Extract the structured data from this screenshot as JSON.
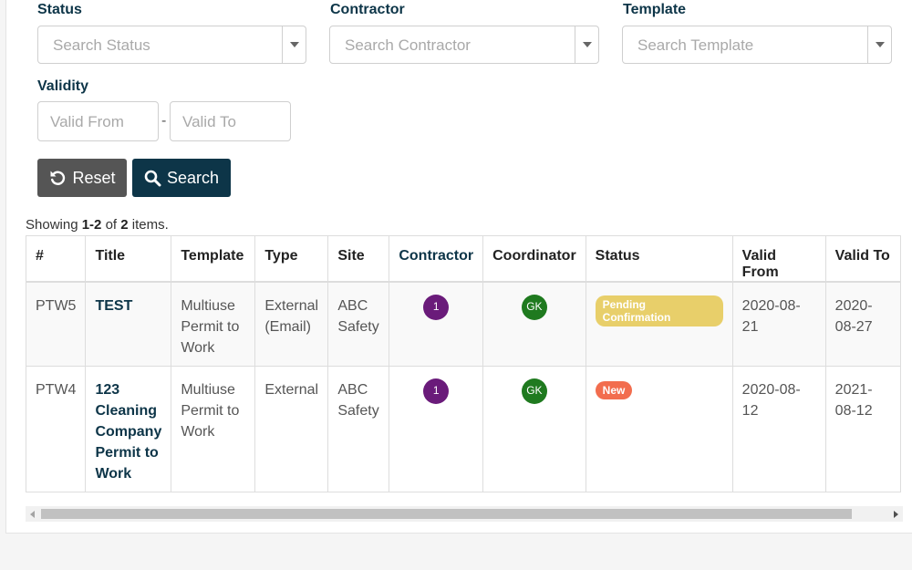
{
  "filters": {
    "status": {
      "label": "Status",
      "placeholder": "Search Status"
    },
    "contractor": {
      "label": "Contractor",
      "placeholder": "Search Contractor"
    },
    "template": {
      "label": "Template",
      "placeholder": "Search Template"
    },
    "validity": {
      "label": "Validity",
      "from_placeholder": "Valid From",
      "to_placeholder": "Valid To",
      "separator": "-"
    }
  },
  "buttons": {
    "reset": "Reset",
    "search": "Search"
  },
  "summary": {
    "prefix": "Showing ",
    "range": "1-2",
    "middle": " of ",
    "total": "2",
    "suffix": " items."
  },
  "table": {
    "columns": [
      "#",
      "Title",
      "Template",
      "Type",
      "Site",
      "Contractor",
      "Coordinator",
      "Status",
      "Valid From",
      "Valid To"
    ],
    "rows": [
      {
        "id": "PTW5",
        "title": "TEST",
        "template": "Multiuse Permit to Work",
        "type": "External (Email)",
        "site": "ABC Safety",
        "contractor": "1",
        "coordinator": "GK",
        "status": "Pending Confirmation",
        "valid_from": "2020-08-21",
        "valid_to": "2020-08-27"
      },
      {
        "id": "PTW4",
        "title": "123 Cleaning Company Permit to Work",
        "template": "Multiuse Permit to Work",
        "type": "External",
        "site": "ABC Safety",
        "contractor": "1",
        "coordinator": "GK",
        "status": "New",
        "valid_from": "2020-08-12",
        "valid_to": "2021-08-12"
      }
    ]
  },
  "colors": {
    "brand": "#0d3548",
    "reset_button": "#555555",
    "contractor_avatar": "#6a1b7a",
    "coordinator_avatar": "#1f7a1f",
    "status_pending": "#e8cf6a",
    "status_new": "#f26d4e"
  },
  "icons": {
    "reset": "undo-icon",
    "search": "search-icon",
    "dropdown": "chevron-down-icon"
  }
}
